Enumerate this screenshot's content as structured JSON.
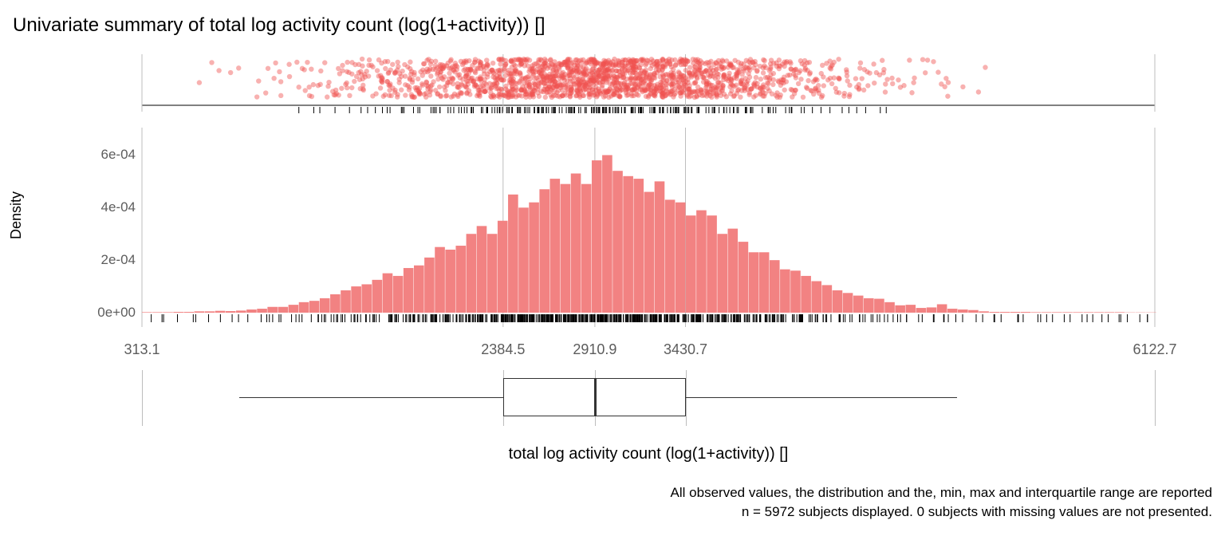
{
  "title": "Univariate summary of total log activity count (log(1+activity)) []",
  "ylabel": "Density",
  "xlabel": "total log activity count (log(1+activity)) []",
  "ticks": {
    "y": [
      "0e+00",
      "2e-04",
      "4e-04",
      "6e-04"
    ],
    "x": [
      "313.1",
      "2384.5",
      "2910.9",
      "3430.7",
      "6122.7"
    ]
  },
  "caption_line1": "All observed values, the distribution and the, min, max and interquartile range are reported",
  "caption_line2": "n = 5972 subjects displayed. 0 subjects with missing values are not presented.",
  "colors": {
    "bar_fill": "#f28282",
    "dot_fill": "#f0514f",
    "grid": "#bdbdbd"
  },
  "chart_data": {
    "type": "area",
    "title": "Univariate summary of total log activity count (log(1+activity)) []",
    "xlabel": "total log activity count (log(1+activity)) []",
    "ylabel": "Density",
    "xlim": [
      313.1,
      6122.7
    ],
    "ylim": [
      0,
      0.00065
    ],
    "x_reference_ticks": [
      313.1,
      2384.5,
      2910.9,
      3430.7,
      6122.7
    ],
    "y_ticks": [
      0,
      0.0002,
      0.0004,
      0.0006
    ],
    "n": 5972,
    "n_missing": 0,
    "boxplot": {
      "min_whisker": 870,
      "q1": 2384.5,
      "median": 2910.9,
      "q3": 3430.7,
      "max_whisker": 4990
    },
    "histogram": {
      "bin_width": 60,
      "bins": [
        {
          "x": 313,
          "density": 2e-06
        },
        {
          "x": 373,
          "density": 2e-06
        },
        {
          "x": 433,
          "density": 2e-06
        },
        {
          "x": 493,
          "density": 3e-06
        },
        {
          "x": 553,
          "density": 3e-06
        },
        {
          "x": 613,
          "density": 5e-06
        },
        {
          "x": 673,
          "density": 5e-06
        },
        {
          "x": 733,
          "density": 7e-06
        },
        {
          "x": 793,
          "density": 6e-06
        },
        {
          "x": 853,
          "density": 8e-06
        },
        {
          "x": 913,
          "density": 1.2e-05
        },
        {
          "x": 973,
          "density": 1.5e-05
        },
        {
          "x": 1033,
          "density": 2.2e-05
        },
        {
          "x": 1093,
          "density": 2.2e-05
        },
        {
          "x": 1153,
          "density": 3e-05
        },
        {
          "x": 1213,
          "density": 4e-05
        },
        {
          "x": 1273,
          "density": 4.5e-05
        },
        {
          "x": 1333,
          "density": 5.5e-05
        },
        {
          "x": 1393,
          "density": 7e-05
        },
        {
          "x": 1453,
          "density": 8.5e-05
        },
        {
          "x": 1513,
          "density": 0.0001
        },
        {
          "x": 1573,
          "density": 0.000108
        },
        {
          "x": 1633,
          "density": 0.000125
        },
        {
          "x": 1693,
          "density": 0.00015
        },
        {
          "x": 1753,
          "density": 0.00014
        },
        {
          "x": 1813,
          "density": 0.00017
        },
        {
          "x": 1873,
          "density": 0.00018
        },
        {
          "x": 1933,
          "density": 0.00021
        },
        {
          "x": 1993,
          "density": 0.00025
        },
        {
          "x": 2053,
          "density": 0.00024
        },
        {
          "x": 2113,
          "density": 0.000255
        },
        {
          "x": 2173,
          "density": 0.0003
        },
        {
          "x": 2233,
          "density": 0.00033
        },
        {
          "x": 2293,
          "density": 0.0003
        },
        {
          "x": 2353,
          "density": 0.00035
        },
        {
          "x": 2413,
          "density": 0.00045
        },
        {
          "x": 2473,
          "density": 0.0004
        },
        {
          "x": 2533,
          "density": 0.00042
        },
        {
          "x": 2593,
          "density": 0.00047
        },
        {
          "x": 2653,
          "density": 0.00051
        },
        {
          "x": 2713,
          "density": 0.00049
        },
        {
          "x": 2773,
          "density": 0.00053
        },
        {
          "x": 2833,
          "density": 0.00049
        },
        {
          "x": 2893,
          "density": 0.00058
        },
        {
          "x": 2953,
          "density": 0.0006
        },
        {
          "x": 3013,
          "density": 0.00054
        },
        {
          "x": 3073,
          "density": 0.00052
        },
        {
          "x": 3133,
          "density": 0.00051
        },
        {
          "x": 3193,
          "density": 0.00046
        },
        {
          "x": 3253,
          "density": 0.0005
        },
        {
          "x": 3313,
          "density": 0.00043
        },
        {
          "x": 3373,
          "density": 0.00042
        },
        {
          "x": 3433,
          "density": 0.00037
        },
        {
          "x": 3493,
          "density": 0.00039
        },
        {
          "x": 3553,
          "density": 0.00037
        },
        {
          "x": 3613,
          "density": 0.0003
        },
        {
          "x": 3673,
          "density": 0.00032
        },
        {
          "x": 3733,
          "density": 0.00027
        },
        {
          "x": 3793,
          "density": 0.00023
        },
        {
          "x": 3853,
          "density": 0.00023
        },
        {
          "x": 3913,
          "density": 0.0002
        },
        {
          "x": 3973,
          "density": 0.000165
        },
        {
          "x": 4033,
          "density": 0.00016
        },
        {
          "x": 4093,
          "density": 0.00014
        },
        {
          "x": 4153,
          "density": 0.00012
        },
        {
          "x": 4213,
          "density": 0.000105
        },
        {
          "x": 4273,
          "density": 8.5e-05
        },
        {
          "x": 4333,
          "density": 7.5e-05
        },
        {
          "x": 4393,
          "density": 6.5e-05
        },
        {
          "x": 4453,
          "density": 5.5e-05
        },
        {
          "x": 4513,
          "density": 5.3e-05
        },
        {
          "x": 4573,
          "density": 4e-05
        },
        {
          "x": 4633,
          "density": 2.8e-05
        },
        {
          "x": 4693,
          "density": 3e-05
        },
        {
          "x": 4753,
          "density": 1.8e-05
        },
        {
          "x": 4813,
          "density": 2e-05
        },
        {
          "x": 4873,
          "density": 3.2e-05
        },
        {
          "x": 4933,
          "density": 1.5e-05
        },
        {
          "x": 4993,
          "density": 1.2e-05
        },
        {
          "x": 5053,
          "density": 1e-05
        },
        {
          "x": 5113,
          "density": 5e-06
        },
        {
          "x": 5173,
          "density": 3e-06
        },
        {
          "x": 5233,
          "density": 3e-06
        },
        {
          "x": 5293,
          "density": 3e-06
        },
        {
          "x": 5353,
          "density": 3e-06
        },
        {
          "x": 5413,
          "density": 2e-06
        },
        {
          "x": 5473,
          "density": 2e-06
        },
        {
          "x": 5533,
          "density": 2e-06
        },
        {
          "x": 5593,
          "density": 2e-06
        },
        {
          "x": 5653,
          "density": 2e-06
        },
        {
          "x": 5713,
          "density": 2e-06
        },
        {
          "x": 5773,
          "density": 2e-06
        },
        {
          "x": 5833,
          "density": 2e-06
        },
        {
          "x": 5893,
          "density": 2e-06
        },
        {
          "x": 5953,
          "density": 1e-06
        },
        {
          "x": 6013,
          "density": 1e-06
        },
        {
          "x": 6073,
          "density": 1e-06
        }
      ]
    }
  }
}
